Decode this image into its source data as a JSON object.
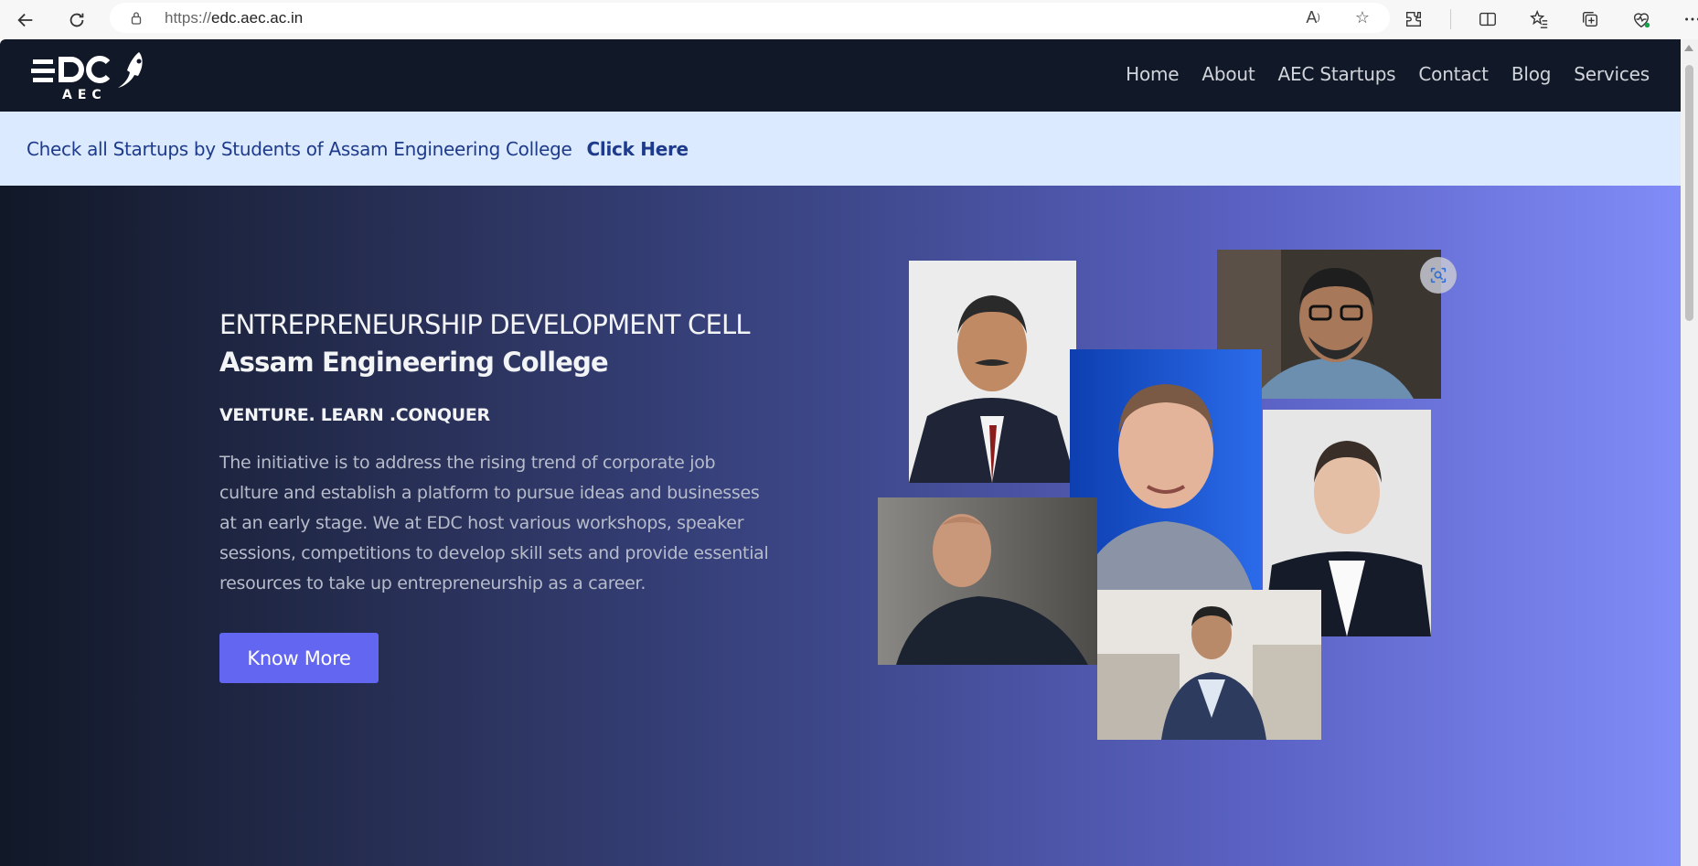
{
  "browser": {
    "url_protocol": "https://",
    "url_host": "edc.aec.ac.in"
  },
  "site": {
    "logo_text": "EDC",
    "logo_sub": "AEC",
    "nav": [
      "Home",
      "About",
      "AEC Startups",
      "Contact",
      "Blog",
      "Services"
    ]
  },
  "announcement": {
    "message": "Check all Startups by Students of Assam Engineering College",
    "cta": "Click Here"
  },
  "hero": {
    "title_line1": "ENTREPRENEURSHIP DEVELOPMENT CELL",
    "title_line2": "Assam Engineering College",
    "tagline": "VENTURE. LEARN .CONQUER",
    "description": "The initiative is to address the rising trend of corporate job culture and establish a platform to pursue ideas and businesses at an early stage. We at EDC host various workshops, speaker sessions, competitions to develop skill sets and provide essential resources to take up entrepreneurship as a career.",
    "button_label": "Know More"
  },
  "colors": {
    "navbar_bg": "#111827",
    "announce_bg": "#dbeafe",
    "accent": "#6366f1"
  }
}
